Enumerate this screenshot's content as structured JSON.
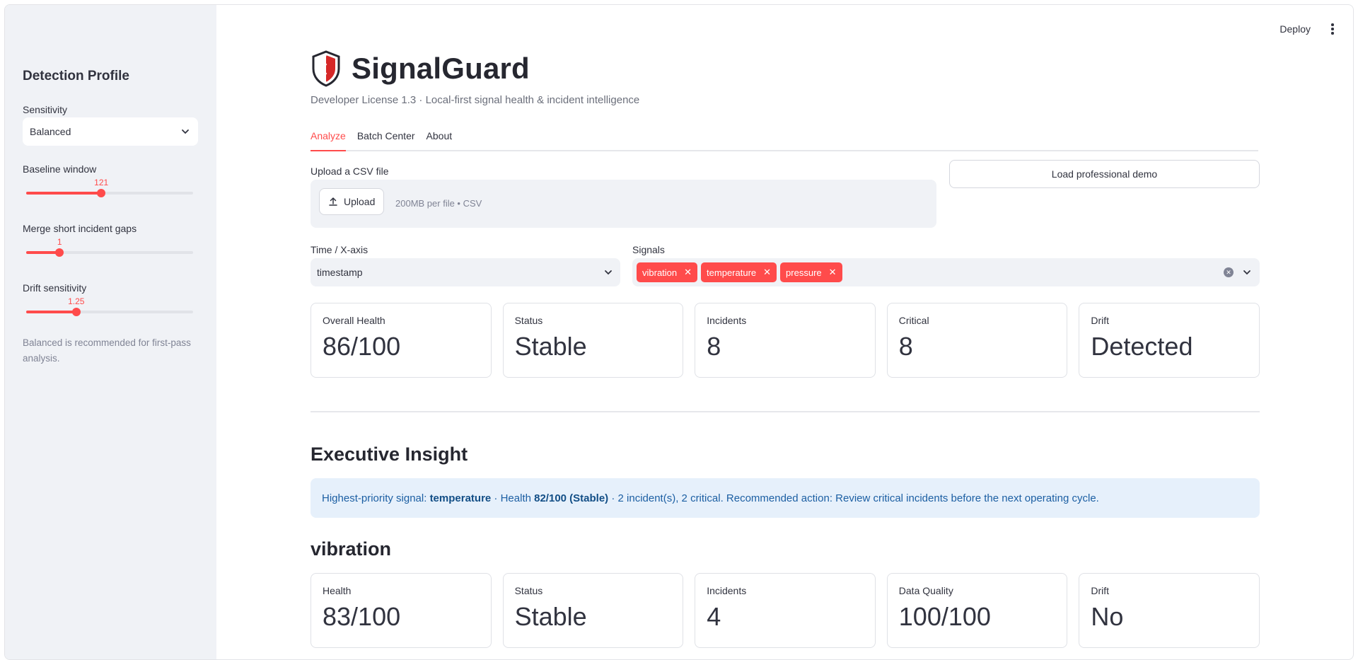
{
  "header": {
    "deploy_label": "Deploy"
  },
  "sidebar": {
    "title": "Detection Profile",
    "sensitivity": {
      "label": "Sensitivity",
      "value": "Balanced"
    },
    "baseline_window": {
      "label": "Baseline window",
      "value": "121",
      "fraction": 0.45
    },
    "merge_gaps": {
      "label": "Merge short incident gaps",
      "value": "1",
      "fraction": 0.2
    },
    "drift_sensitivity": {
      "label": "Drift sensitivity",
      "value": "1.25",
      "fraction": 0.3
    },
    "note": "Balanced is recommended for first-pass analysis."
  },
  "app": {
    "title": "SignalGuard",
    "subtitle": "Developer License 1.3 · Local-first signal health & incident intelligence",
    "tabs": [
      "Analyze",
      "Batch Center",
      "About"
    ],
    "active_tab": "Analyze"
  },
  "upload": {
    "label": "Upload a CSV file",
    "button": "Upload",
    "hint": "200MB per file • CSV",
    "demo_button": "Load professional demo"
  },
  "time_axis": {
    "label": "Time / X-axis",
    "value": "timestamp"
  },
  "signals": {
    "label": "Signals",
    "selected": [
      "vibration",
      "temperature",
      "pressure"
    ]
  },
  "overview": [
    {
      "label": "Overall Health",
      "value": "86/100"
    },
    {
      "label": "Status",
      "value": "Stable"
    },
    {
      "label": "Incidents",
      "value": "8"
    },
    {
      "label": "Critical",
      "value": "8"
    },
    {
      "label": "Drift",
      "value": "Detected"
    }
  ],
  "insight": {
    "title": "Executive Insight",
    "prefix": "Highest-priority signal: ",
    "signal": "temperature",
    "mid": " · Health ",
    "health": "82/100 (Stable)",
    "suffix": " · 2 incident(s), 2 critical. Recommended action: Review critical incidents before the next operating cycle."
  },
  "signal_section": {
    "title": "vibration",
    "metrics": [
      {
        "label": "Health",
        "value": "83/100"
      },
      {
        "label": "Status",
        "value": "Stable"
      },
      {
        "label": "Incidents",
        "value": "4"
      },
      {
        "label": "Data Quality",
        "value": "100/100"
      },
      {
        "label": "Drift",
        "value": "No"
      }
    ]
  },
  "colors": {
    "accent": "#ff4b4b",
    "info_bg": "#e6f0fb",
    "info_text": "#1c5fa3",
    "sidebar_bg": "#f0f2f6"
  }
}
